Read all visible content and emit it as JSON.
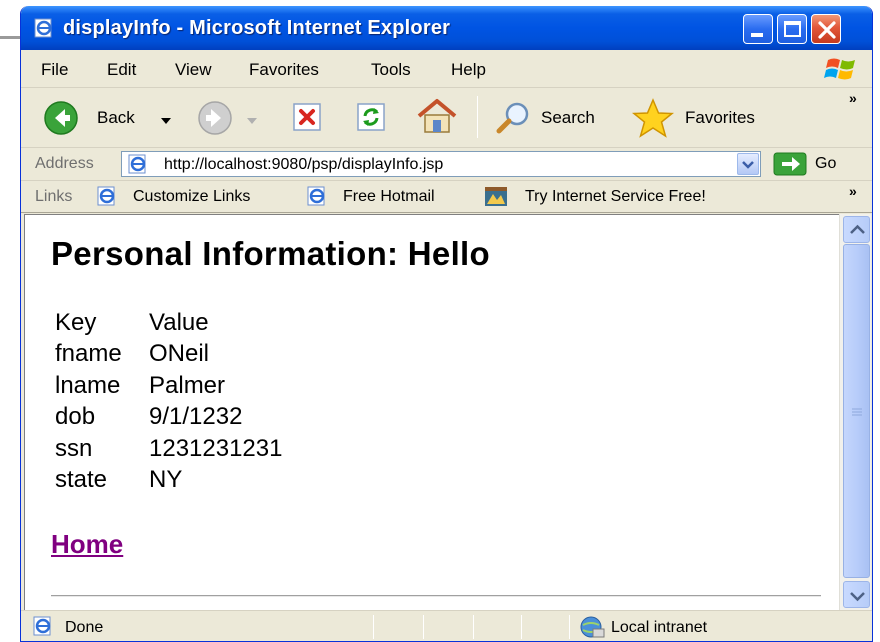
{
  "window": {
    "title": "displayInfo - Microsoft Internet Explorer"
  },
  "menu": {
    "items": [
      "File",
      "Edit",
      "View",
      "Favorites",
      "Tools",
      "Help"
    ]
  },
  "toolbar": {
    "back_label": "Back",
    "search_label": "Search",
    "favorites_label": "Favorites",
    "chevron": "»"
  },
  "address": {
    "label": "Address",
    "url": "http://localhost:9080/psp/displayInfo.jsp",
    "go_label": "Go"
  },
  "links": {
    "label": "Links",
    "items": [
      "Customize Links",
      "Free Hotmail",
      "Try Internet Service Free!"
    ],
    "chevron": "»"
  },
  "page": {
    "title": "Personal Information: Hello",
    "table": {
      "header": [
        "Key",
        "Value"
      ],
      "rows": [
        [
          "fname",
          "ONeil"
        ],
        [
          "lname",
          "Palmer"
        ],
        [
          "dob",
          "9/1/1232"
        ],
        [
          "ssn",
          "1231231231"
        ],
        [
          "state",
          "NY"
        ]
      ]
    },
    "home_link": "Home"
  },
  "status": {
    "text": "Done",
    "zone": "Local intranet"
  },
  "colors": {
    "titlebar": "#0054e3",
    "visited_link": "#800080",
    "chrome": "#ece9d8"
  }
}
